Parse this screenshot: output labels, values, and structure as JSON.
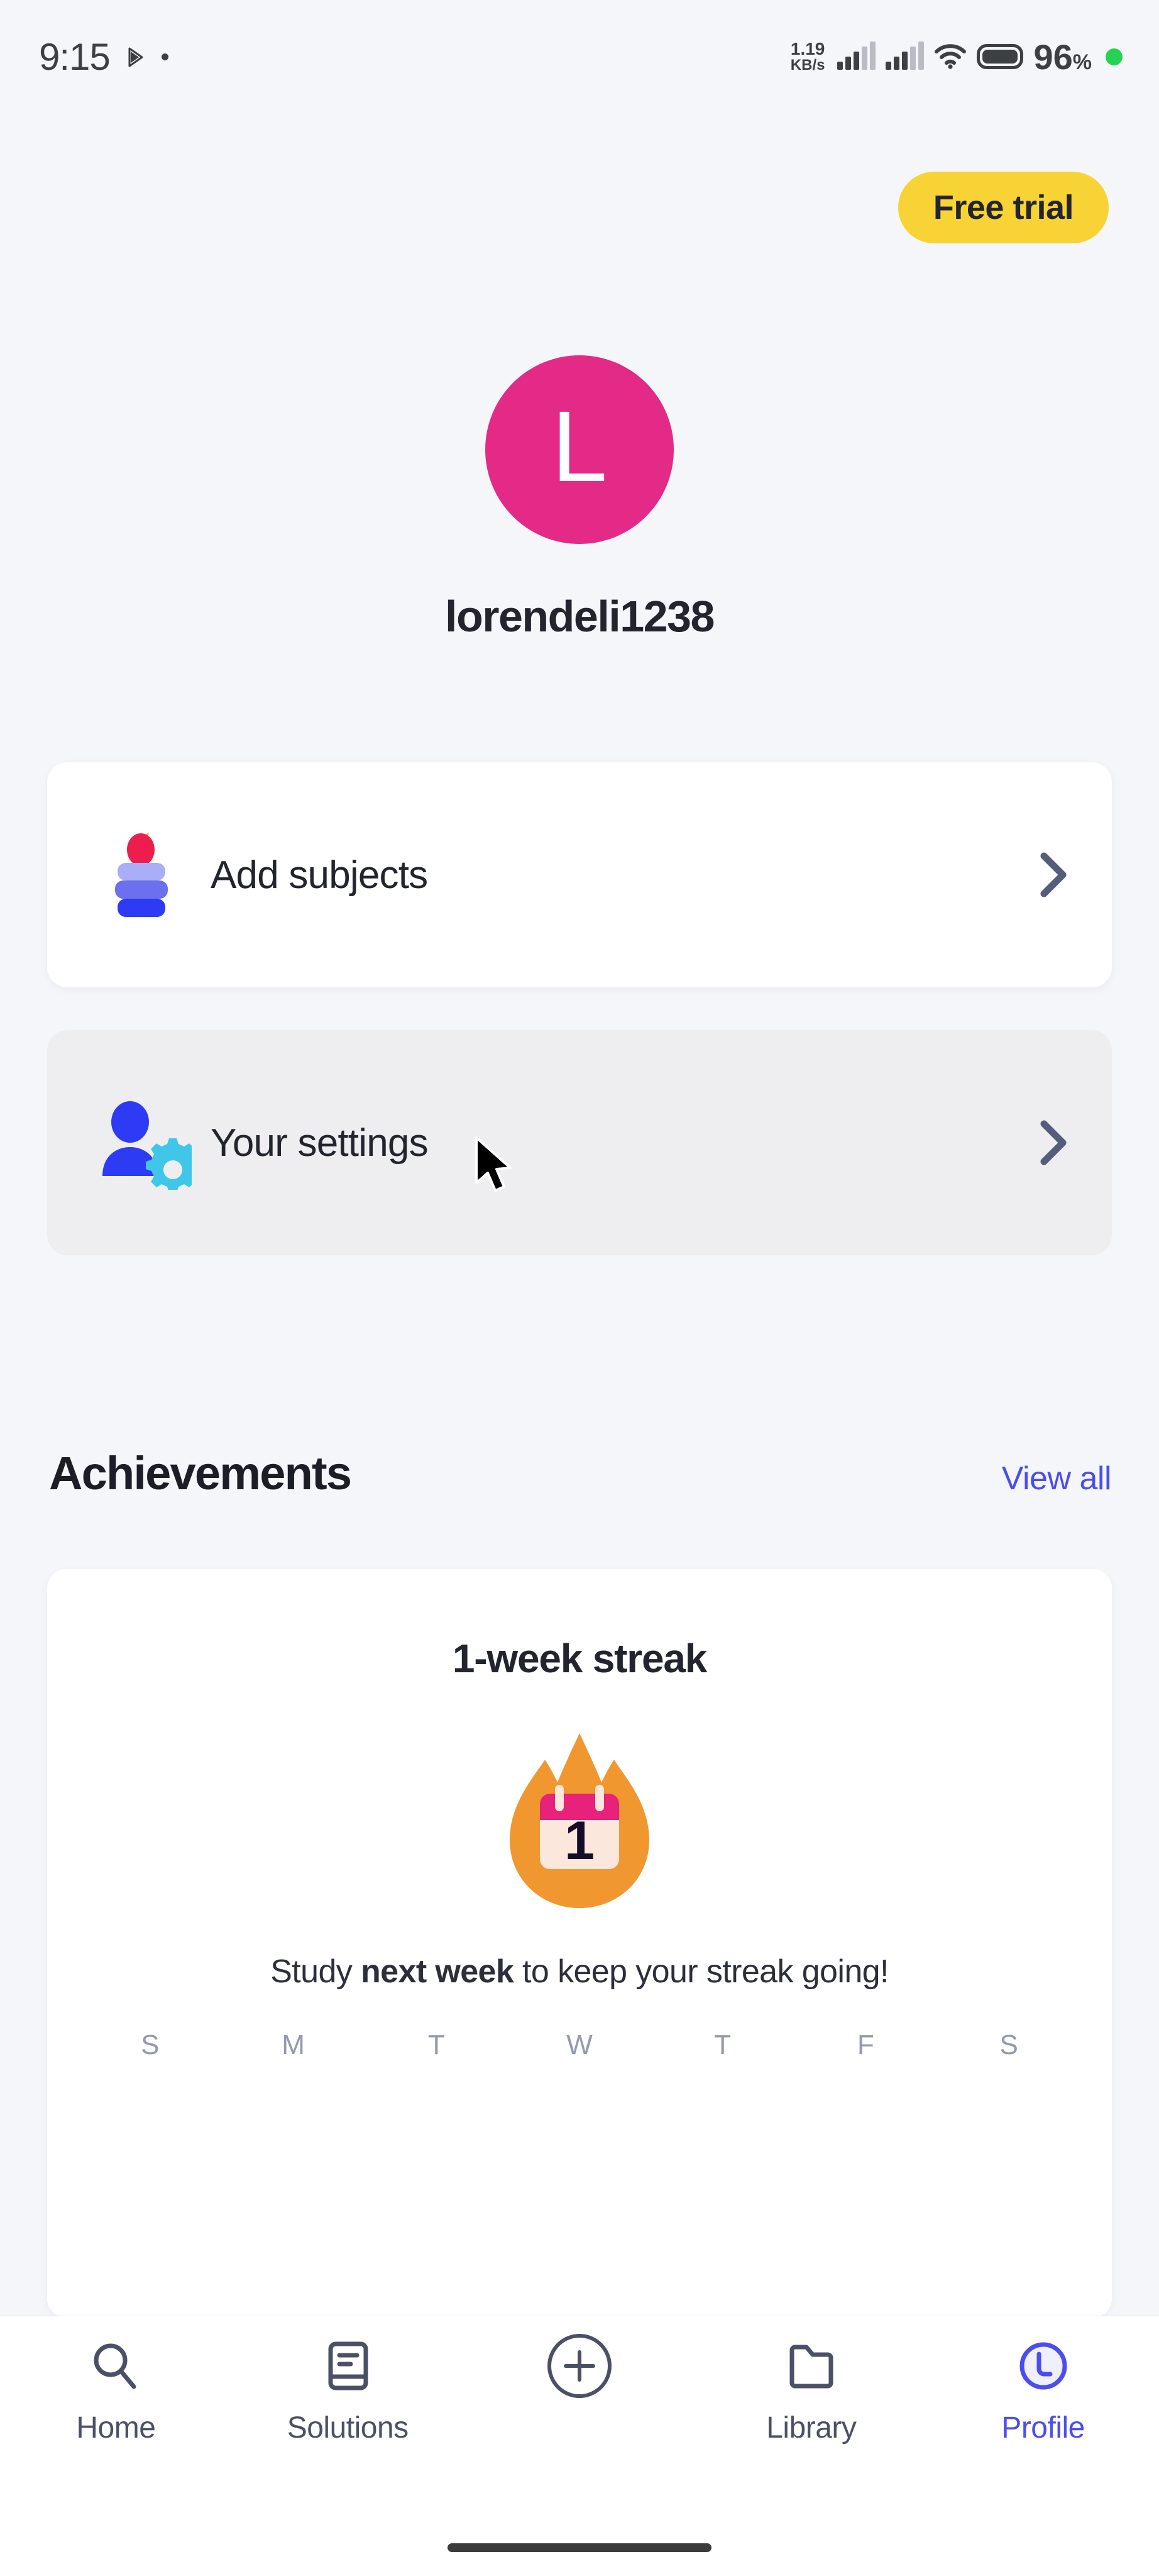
{
  "statusbar": {
    "time": "9:15",
    "play_icon": "play-icon",
    "dot_icon": "recording-dot-icon",
    "net_rate_value": "1.19",
    "net_rate_unit": "KB/s",
    "signal_icon_1": "cellular-signal-icon",
    "signal_icon_2": "cellular-signal-icon",
    "wifi_icon": "wifi-icon",
    "battery_icon": "battery-icon",
    "battery_percent": "96",
    "percent_sign": "%",
    "green_dot_icon": "status-green-dot-icon"
  },
  "header": {
    "trial_badge": "Free trial",
    "trial_badge_color": "#F7D336"
  },
  "profile": {
    "avatar_initial": "L",
    "avatar_color": "#E32A86",
    "username": "lorendeli1238"
  },
  "rows": [
    {
      "key": "add-subjects",
      "label": "Add subjects",
      "icon": "books-stack-apple-icon",
      "chevron": "chevron-right-icon",
      "background": "#FFFFFF"
    },
    {
      "key": "your-settings",
      "label": "Your settings",
      "icon": "user-gear-icon",
      "chevron": "chevron-right-icon",
      "background": "#EEEEF0"
    }
  ],
  "achievements": {
    "title": "Achievements",
    "view_all": "View all",
    "view_all_color": "#4B4EEE",
    "card": {
      "title": "1-week streak",
      "icon": "flame-calendar-icon",
      "calendar_day": "1",
      "description_prefix": "Study ",
      "description_bold": "next week",
      "description_suffix": " to keep your streak going!",
      "weekdays": [
        "S",
        "M",
        "T",
        "W",
        "T",
        "F",
        "S"
      ]
    }
  },
  "bottom_nav": {
    "items": [
      {
        "label": "Home",
        "icon": "search-icon",
        "active": false
      },
      {
        "label": "Solutions",
        "icon": "book-icon",
        "active": false
      },
      {
        "label": "",
        "icon": "plus-circle-icon",
        "active": false
      },
      {
        "label": "Library",
        "icon": "folder-icon",
        "active": false
      },
      {
        "label": "Profile",
        "icon": "profile-circle-icon",
        "active": true
      }
    ],
    "active_color": "#4B4EEE",
    "inactive_color": "#4B5066"
  },
  "system": {
    "home_indicator": "home-indicator",
    "cursor": "mouse-cursor"
  }
}
